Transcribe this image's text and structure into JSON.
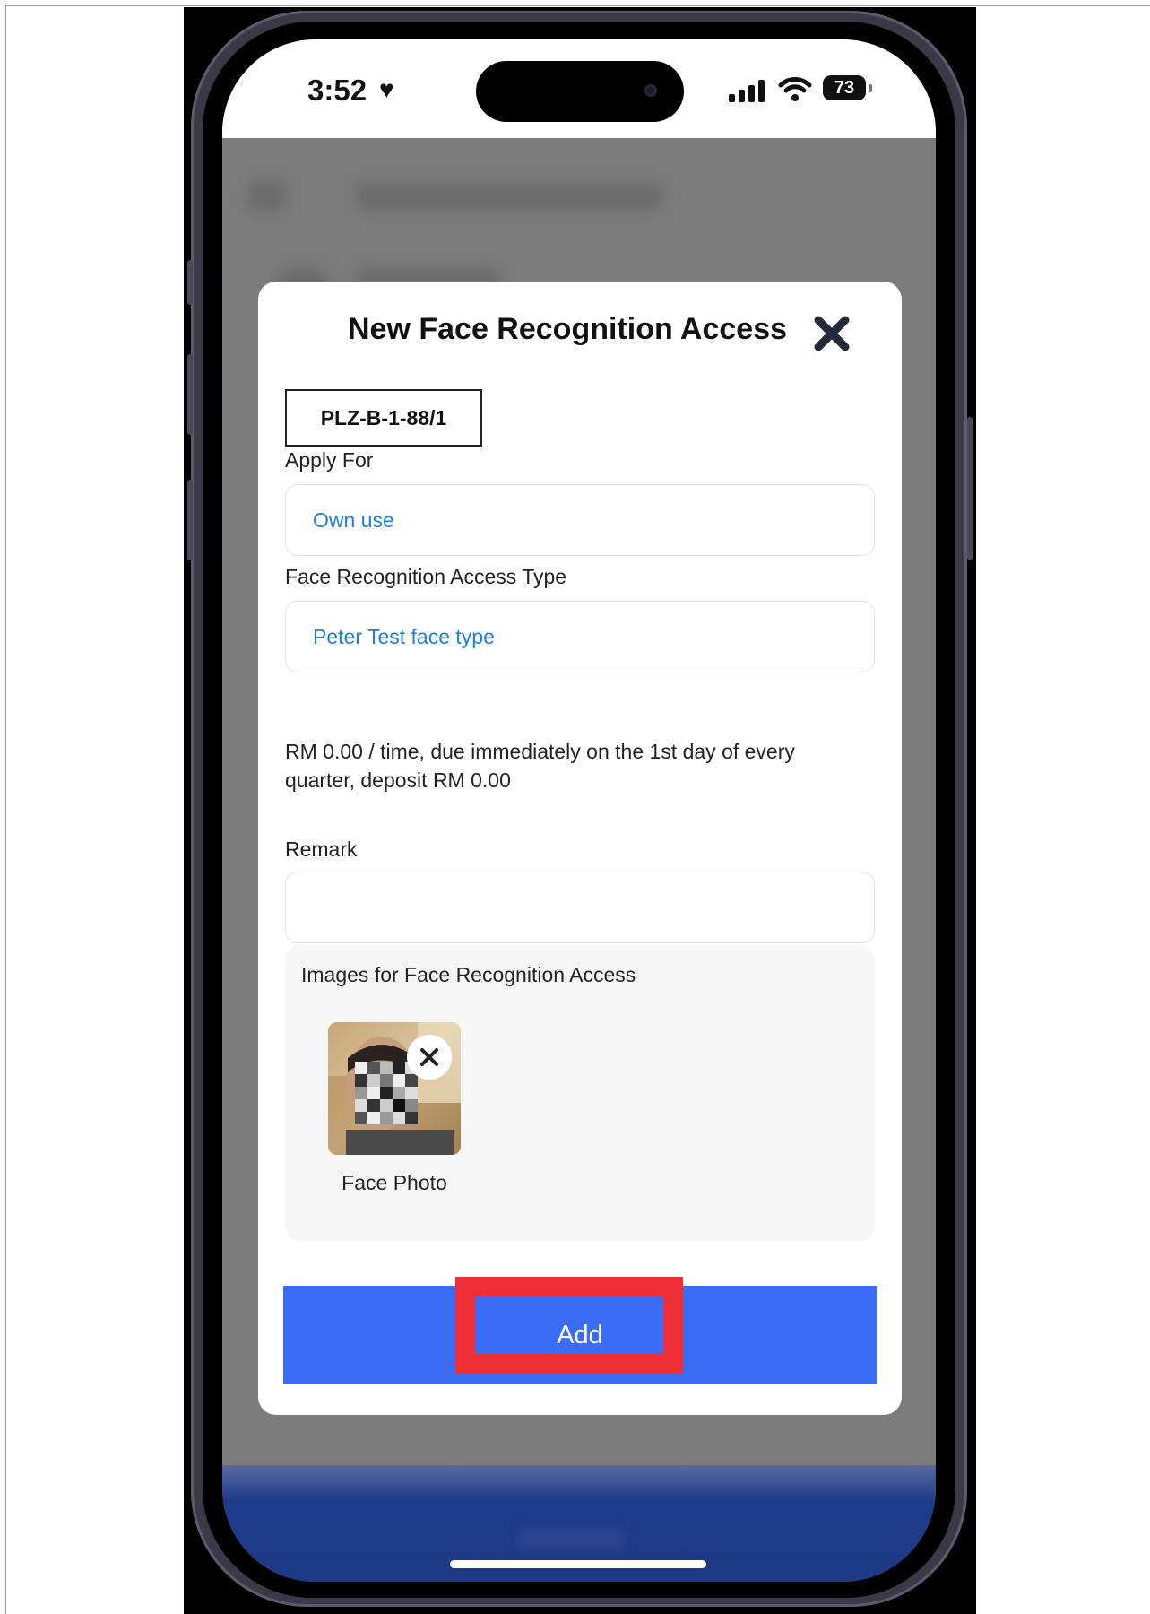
{
  "status_bar": {
    "time": "3:52",
    "battery": "73"
  },
  "modal": {
    "title": "New Face Recognition Access",
    "unit_code": "PLZ-B-1-88/1",
    "apply_for": {
      "label": "Apply For",
      "value": "Own use"
    },
    "access_type": {
      "label": "Face Recognition Access Type",
      "value": "Peter Test face type"
    },
    "price_info": "RM 0.00 / time, due immediately on the 1st day of every quarter, deposit RM 0.00",
    "remark": {
      "label": "Remark",
      "value": ""
    },
    "images": {
      "title": "Images for Face Recognition Access",
      "items": [
        {
          "caption": "Face Photo"
        }
      ]
    },
    "add_button": "Add"
  },
  "colors": {
    "accent": "#3a6cf5",
    "link": "#1e7fd8",
    "highlight": "#ef2e36",
    "bottom_bar": "#1e3a8a"
  },
  "icons": {
    "close": "close-icon",
    "remove_photo": "remove-photo-icon",
    "signal": "cellular-signal-icon",
    "wifi": "wifi-icon",
    "battery": "battery-icon",
    "heart": "heart-icon"
  }
}
